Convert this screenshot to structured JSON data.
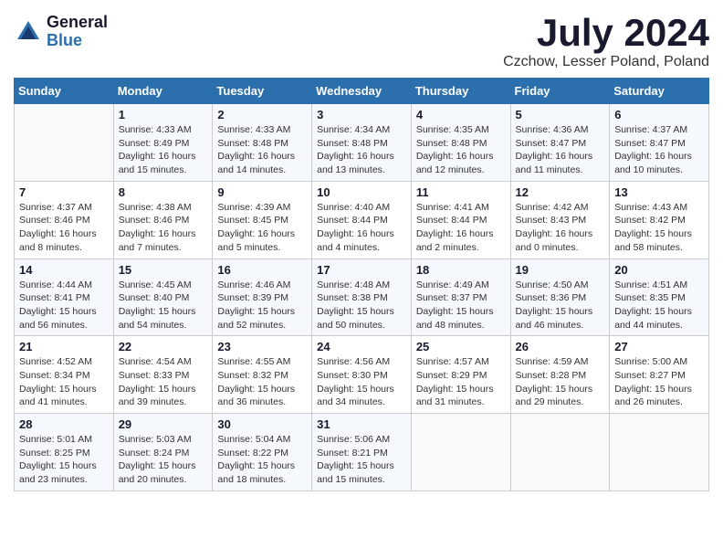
{
  "logo": {
    "general": "General",
    "blue": "Blue"
  },
  "title": {
    "month": "July 2024",
    "location": "Czchow, Lesser Poland, Poland"
  },
  "weekdays": [
    "Sunday",
    "Monday",
    "Tuesday",
    "Wednesday",
    "Thursday",
    "Friday",
    "Saturday"
  ],
  "weeks": [
    [
      {
        "day": "",
        "info": ""
      },
      {
        "day": "1",
        "info": "Sunrise: 4:33 AM\nSunset: 8:49 PM\nDaylight: 16 hours\nand 15 minutes."
      },
      {
        "day": "2",
        "info": "Sunrise: 4:33 AM\nSunset: 8:48 PM\nDaylight: 16 hours\nand 14 minutes."
      },
      {
        "day": "3",
        "info": "Sunrise: 4:34 AM\nSunset: 8:48 PM\nDaylight: 16 hours\nand 13 minutes."
      },
      {
        "day": "4",
        "info": "Sunrise: 4:35 AM\nSunset: 8:48 PM\nDaylight: 16 hours\nand 12 minutes."
      },
      {
        "day": "5",
        "info": "Sunrise: 4:36 AM\nSunset: 8:47 PM\nDaylight: 16 hours\nand 11 minutes."
      },
      {
        "day": "6",
        "info": "Sunrise: 4:37 AM\nSunset: 8:47 PM\nDaylight: 16 hours\nand 10 minutes."
      }
    ],
    [
      {
        "day": "7",
        "info": "Sunrise: 4:37 AM\nSunset: 8:46 PM\nDaylight: 16 hours\nand 8 minutes."
      },
      {
        "day": "8",
        "info": "Sunrise: 4:38 AM\nSunset: 8:46 PM\nDaylight: 16 hours\nand 7 minutes."
      },
      {
        "day": "9",
        "info": "Sunrise: 4:39 AM\nSunset: 8:45 PM\nDaylight: 16 hours\nand 5 minutes."
      },
      {
        "day": "10",
        "info": "Sunrise: 4:40 AM\nSunset: 8:44 PM\nDaylight: 16 hours\nand 4 minutes."
      },
      {
        "day": "11",
        "info": "Sunrise: 4:41 AM\nSunset: 8:44 PM\nDaylight: 16 hours\nand 2 minutes."
      },
      {
        "day": "12",
        "info": "Sunrise: 4:42 AM\nSunset: 8:43 PM\nDaylight: 16 hours\nand 0 minutes."
      },
      {
        "day": "13",
        "info": "Sunrise: 4:43 AM\nSunset: 8:42 PM\nDaylight: 15 hours\nand 58 minutes."
      }
    ],
    [
      {
        "day": "14",
        "info": "Sunrise: 4:44 AM\nSunset: 8:41 PM\nDaylight: 15 hours\nand 56 minutes."
      },
      {
        "day": "15",
        "info": "Sunrise: 4:45 AM\nSunset: 8:40 PM\nDaylight: 15 hours\nand 54 minutes."
      },
      {
        "day": "16",
        "info": "Sunrise: 4:46 AM\nSunset: 8:39 PM\nDaylight: 15 hours\nand 52 minutes."
      },
      {
        "day": "17",
        "info": "Sunrise: 4:48 AM\nSunset: 8:38 PM\nDaylight: 15 hours\nand 50 minutes."
      },
      {
        "day": "18",
        "info": "Sunrise: 4:49 AM\nSunset: 8:37 PM\nDaylight: 15 hours\nand 48 minutes."
      },
      {
        "day": "19",
        "info": "Sunrise: 4:50 AM\nSunset: 8:36 PM\nDaylight: 15 hours\nand 46 minutes."
      },
      {
        "day": "20",
        "info": "Sunrise: 4:51 AM\nSunset: 8:35 PM\nDaylight: 15 hours\nand 44 minutes."
      }
    ],
    [
      {
        "day": "21",
        "info": "Sunrise: 4:52 AM\nSunset: 8:34 PM\nDaylight: 15 hours\nand 41 minutes."
      },
      {
        "day": "22",
        "info": "Sunrise: 4:54 AM\nSunset: 8:33 PM\nDaylight: 15 hours\nand 39 minutes."
      },
      {
        "day": "23",
        "info": "Sunrise: 4:55 AM\nSunset: 8:32 PM\nDaylight: 15 hours\nand 36 minutes."
      },
      {
        "day": "24",
        "info": "Sunrise: 4:56 AM\nSunset: 8:30 PM\nDaylight: 15 hours\nand 34 minutes."
      },
      {
        "day": "25",
        "info": "Sunrise: 4:57 AM\nSunset: 8:29 PM\nDaylight: 15 hours\nand 31 minutes."
      },
      {
        "day": "26",
        "info": "Sunrise: 4:59 AM\nSunset: 8:28 PM\nDaylight: 15 hours\nand 29 minutes."
      },
      {
        "day": "27",
        "info": "Sunrise: 5:00 AM\nSunset: 8:27 PM\nDaylight: 15 hours\nand 26 minutes."
      }
    ],
    [
      {
        "day": "28",
        "info": "Sunrise: 5:01 AM\nSunset: 8:25 PM\nDaylight: 15 hours\nand 23 minutes."
      },
      {
        "day": "29",
        "info": "Sunrise: 5:03 AM\nSunset: 8:24 PM\nDaylight: 15 hours\nand 20 minutes."
      },
      {
        "day": "30",
        "info": "Sunrise: 5:04 AM\nSunset: 8:22 PM\nDaylight: 15 hours\nand 18 minutes."
      },
      {
        "day": "31",
        "info": "Sunrise: 5:06 AM\nSunset: 8:21 PM\nDaylight: 15 hours\nand 15 minutes."
      },
      {
        "day": "",
        "info": ""
      },
      {
        "day": "",
        "info": ""
      },
      {
        "day": "",
        "info": ""
      }
    ]
  ]
}
